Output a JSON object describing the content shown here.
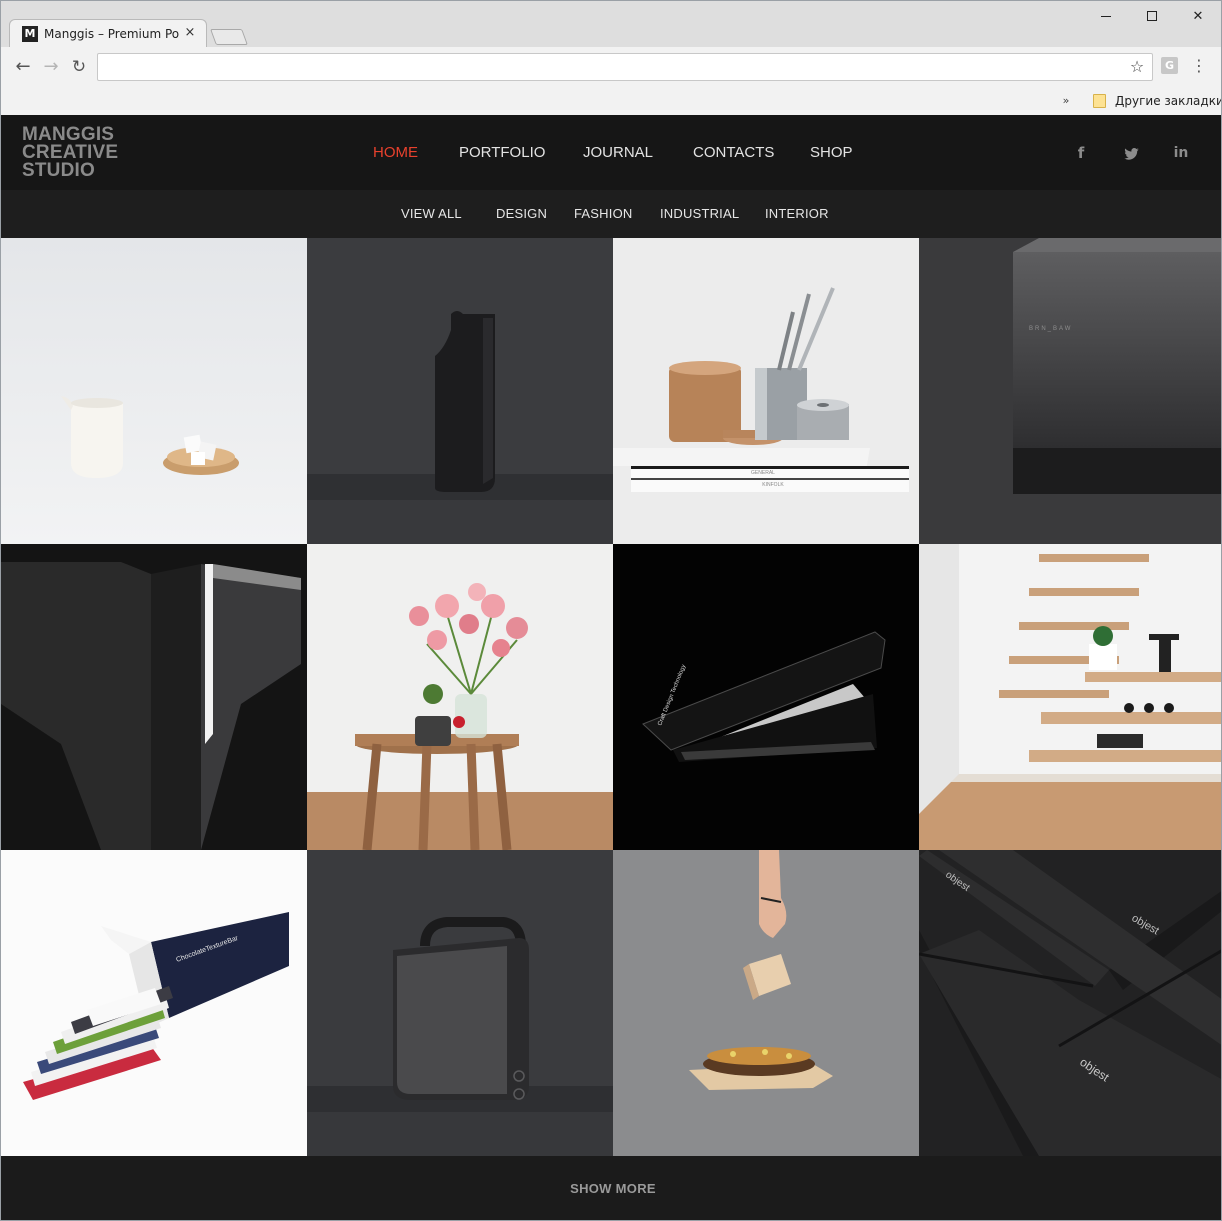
{
  "browser": {
    "tab_title": "Manggis – Premium Portf",
    "tab_favicon_letter": "M",
    "tab_close": "×",
    "address_value": "",
    "bookmark_folder_label": "Другие закладки",
    "bookmark_overflow": "»",
    "extension_letter": "G",
    "icons": {
      "back": "back-arrow-icon",
      "forward": "forward-arrow-icon",
      "reload": "reload-icon",
      "star": "star-icon",
      "menu": "kebab-menu-icon"
    }
  },
  "site": {
    "logo_lines": [
      "MANGGIS",
      "CREATIVE",
      "STUDIO"
    ],
    "nav": [
      {
        "label": "HOME",
        "active": true
      },
      {
        "label": "PORTFOLIO",
        "active": false
      },
      {
        "label": "JOURNAL",
        "active": false
      },
      {
        "label": "CONTACTS",
        "active": false
      },
      {
        "label": "SHOP",
        "active": false
      }
    ],
    "social": [
      "facebook-icon",
      "twitter-icon",
      "linkedin-icon"
    ],
    "filters": [
      "VIEW ALL",
      "DESIGN",
      "FASHION",
      "INDUSTRIAL",
      "INTERIOR"
    ],
    "show_more": "SHOW MORE",
    "colors": {
      "header_bg": "#161616",
      "subnav_bg": "#1e1e1e",
      "active_nav": "#e8412d",
      "logo": "#8a8a8a"
    }
  },
  "portfolio": {
    "items": [
      {
        "subject": "ceramic-pitcher-and-sugar-bowl"
      },
      {
        "subject": "black-leather-bottle"
      },
      {
        "subject": "desk-organizer-with-pens-on-books",
        "book_labels": [
          "GENERAL",
          "KINFOLK",
          "GENERAL"
        ]
      },
      {
        "subject": "black-speaker-box",
        "print": "BRN_BAW"
      },
      {
        "subject": "black-sculptural-towers"
      },
      {
        "subject": "flowers-on-wooden-stool"
      },
      {
        "subject": "black-stapler",
        "print": "Craft Design Technology"
      },
      {
        "subject": "floating-staircase-shelves"
      },
      {
        "subject": "chocolate-texture-bar-boxes",
        "print": "ChocolateTextureBar"
      },
      {
        "subject": "fabric-bluetooth-speaker"
      },
      {
        "subject": "hand-holding-wooden-block-over-food"
      },
      {
        "subject": "objest-black-boxes",
        "print": "objest"
      }
    ]
  }
}
